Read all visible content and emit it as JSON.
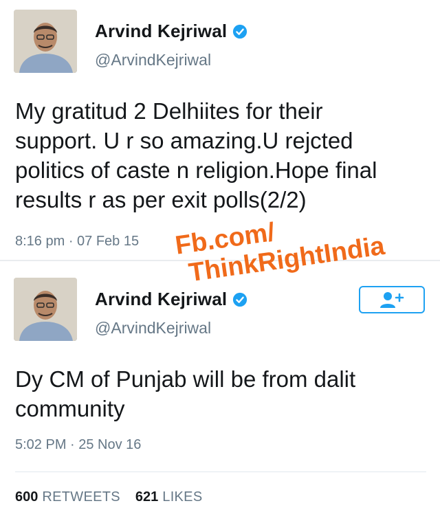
{
  "tweet1": {
    "name": "Arvind Kejriwal",
    "handle": "@ArvindKejriwal",
    "text": "My gratitud 2 Delhiites for their\nsupport. U r so amazing.U rejcted\npolitics of caste n religion.Hope final\nresults r as per exit polls(2/2)",
    "timestamp": "8:16 pm · 07 Feb 15"
  },
  "watermark": {
    "line1": "Fb.com/",
    "line2": "ThinkRightIndia",
    "color": "#f06a1a"
  },
  "tweet2": {
    "name": "Arvind Kejriwal",
    "handle": "@ArvindKejriwal",
    "text": "Dy CM of Punjab will be from dalit\ncommunity",
    "timestamp": "5:02 PM · 25 Nov 16",
    "follow_icon": "add-user-icon",
    "stats": {
      "retweets_count": "600",
      "retweets_label": "RETWEETS",
      "likes_count": "621",
      "likes_label": "LIKES"
    }
  },
  "colors": {
    "accent": "#1da1f2",
    "text": "#14171a",
    "secondary": "#657786"
  }
}
